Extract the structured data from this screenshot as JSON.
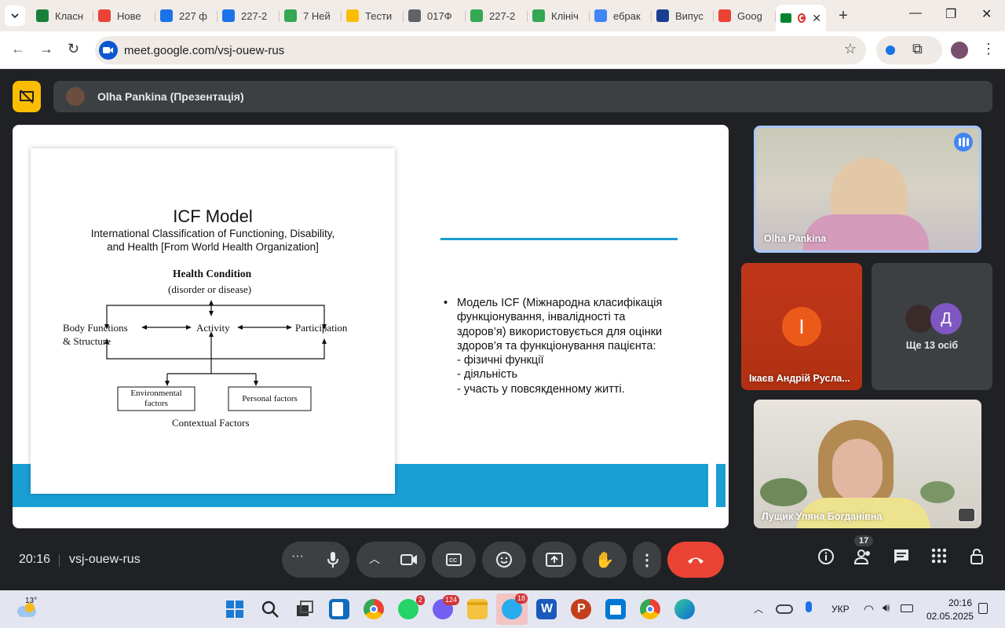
{
  "browser": {
    "tabs": [
      {
        "label": "Класн",
        "color": "#188038"
      },
      {
        "label": "Нове",
        "color": "#ea4335"
      },
      {
        "label": "227 ф",
        "color": "#1a73e8"
      },
      {
        "label": "227-2",
        "color": "#1a73e8"
      },
      {
        "label": "7 Ней",
        "color": "#34a853"
      },
      {
        "label": "Тести",
        "color": "#fbbc04"
      },
      {
        "label": "017Ф",
        "color": "#5f6368"
      },
      {
        "label": "227-2",
        "color": "#34a853"
      },
      {
        "label": "Клініч",
        "color": "#34a853"
      },
      {
        "label": "ебрак",
        "color": "#4285f4"
      },
      {
        "label": "Випус",
        "color": "#1a3d8f"
      },
      {
        "label": "Goog",
        "color": "#ea4335"
      }
    ],
    "url": "meet.google.com/vsj-ouew-rus"
  },
  "meet": {
    "presenter_label": "Olha Pankina (Презентація)",
    "slide": {
      "title": "ICF Model",
      "subtitle_line1": "International Classification of Functioning, Disability,",
      "subtitle_line2": "and Health [From World Health Organization]",
      "health_condition": "Health Condition",
      "disorder": "(disorder or disease)",
      "body_functions_1": "Body Functions",
      "body_functions_2": "& Structure",
      "activity": "Activity",
      "participation": "Participation",
      "environmental_1": "Environmental",
      "environmental_2": "factors",
      "personal": "Personal factors",
      "contextual": "Contextual Factors",
      "bullet_lines": [
        "Модель ICF (Міжнародна класифікація",
        "функціонування, інвалідності та",
        "здоров’я) використовується для оцінки",
        "здоров’я та функціонування пацієнта:",
        "- фізичні функції",
        "- діяльність",
        "- участь у повсякденному житті."
      ]
    },
    "tiles": {
      "main_name": "Olha Pankina",
      "ikaev_initial": "І",
      "ikaev_name": "Ікаєв Андрій Русла...",
      "others_initial": "Д",
      "others_label": "Ще 13 осіб",
      "bottom_name": "Лущик Уляна Богданівна"
    },
    "time": "20:16",
    "meeting_code": "vsj-ouew-rus",
    "participants_count": "17"
  },
  "taskbar": {
    "weather_temp": "13°",
    "whatsapp_badge": "2",
    "viber_badge": "124",
    "telegram_badge": "18",
    "language": "УКР",
    "clock_time": "20:16",
    "clock_date": "02.05.2025"
  }
}
